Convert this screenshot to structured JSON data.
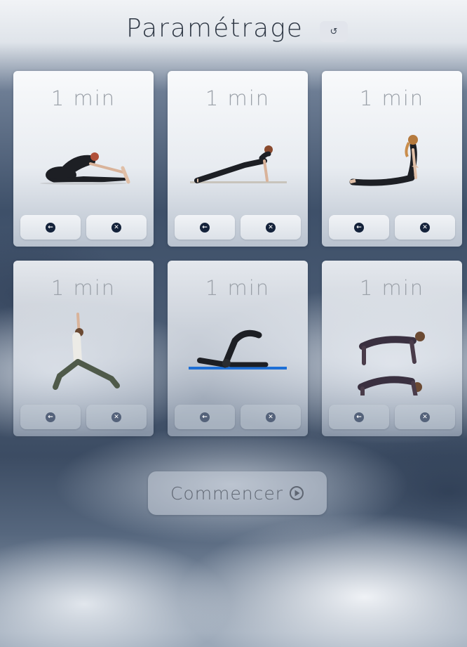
{
  "header": {
    "title": "Paramétrage",
    "reset_icon": "undo-icon",
    "reset_glyph": "↺"
  },
  "cards": [
    {
      "duration": "1 min",
      "exercise_image": "seated-forward-fold-pose",
      "back_icon": "arrow-left-circle-icon",
      "remove_icon": "close-circle-icon"
    },
    {
      "duration": "1 min",
      "exercise_image": "plank-pose",
      "back_icon": "arrow-left-circle-icon",
      "remove_icon": "close-circle-icon"
    },
    {
      "duration": "1 min",
      "exercise_image": "cobra-pose",
      "back_icon": "arrow-left-circle-icon",
      "remove_icon": "close-circle-icon"
    },
    {
      "duration": "1 min",
      "exercise_image": "warrior-pose",
      "back_icon": "arrow-left-circle-icon",
      "remove_icon": "close-circle-icon"
    },
    {
      "duration": "1 min",
      "exercise_image": "plow-pose",
      "back_icon": "arrow-left-circle-icon",
      "remove_icon": "close-circle-icon"
    },
    {
      "duration": "1 min",
      "exercise_image": "cat-cow-pose",
      "back_icon": "arrow-left-circle-icon",
      "remove_icon": "close-circle-icon"
    }
  ],
  "glyphs": {
    "back": "←",
    "remove": "✕"
  },
  "start": {
    "label": "Commencer",
    "icon": "play-circle-icon"
  },
  "colors": {
    "icon": "#14223a",
    "title": "#2e3744",
    "duration": "#9aa0a8"
  }
}
